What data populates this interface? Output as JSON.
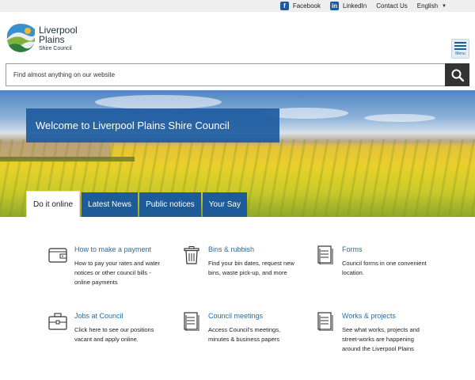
{
  "topbar": {
    "facebook": "Facebook",
    "linkedin": "LinkedIn",
    "contact": "Contact Us",
    "language": "English"
  },
  "logo": {
    "line1": "Liverpool",
    "line2": "Plains",
    "line3": "Shire Council"
  },
  "menu": {
    "label": "Menu"
  },
  "search": {
    "placeholder": "Find almost anything on our website"
  },
  "hero": {
    "welcome": "Welcome to Liverpool Plains Shire Council"
  },
  "tabs": [
    {
      "label": "Do it online"
    },
    {
      "label": "Latest News"
    },
    {
      "label": "Public notices"
    },
    {
      "label": "Your Say"
    }
  ],
  "cards": [
    {
      "title": "How to make a payment",
      "desc": "How to pay your rates and water notices or other council bills - online payments",
      "icon": "wallet-icon"
    },
    {
      "title": "Bins & rubbish",
      "desc": "Find your bin dates, request new bins, waste pick-up, and more",
      "icon": "bin-icon"
    },
    {
      "title": "Forms",
      "desc": "Council forms in one convenient location.",
      "icon": "document-icon"
    },
    {
      "title": "Jobs at Council",
      "desc": "Click here to see our positions vacant and apply online.",
      "icon": "briefcase-icon"
    },
    {
      "title": "Council meetings",
      "desc": "Access Council's meetings, minutes & business papers",
      "icon": "document-icon"
    },
    {
      "title": "Works & projects",
      "desc": "See what works, projects and street-works are happening around the Liverpool Plains",
      "icon": "document-icon"
    }
  ],
  "colors": {
    "accent": "#1d5b99",
    "link": "#1d6fb0"
  }
}
